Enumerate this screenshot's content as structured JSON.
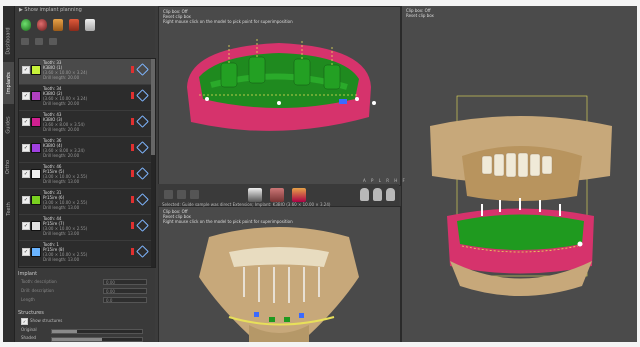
{
  "titlebar": "▶ Show implant planning",
  "side_tabs": [
    "Dashboard",
    "Implants",
    "Guides",
    "Ortho",
    "Teeth"
  ],
  "implants": [
    {
      "title": "Tooth: 33",
      "model": "K3BIO (1)",
      "dims": "(3.60 × 10.00 × 3.24)",
      "drill": "Drill length: 20.00",
      "color": "#c7f23a",
      "selected": true
    },
    {
      "title": "Tooth: 34",
      "model": "K3BIO (2)",
      "dims": "(3.60 × 10.00 × 3.24)",
      "drill": "Drill length: 20.00",
      "color": "#b040c0",
      "selected": false
    },
    {
      "title": "Tooth: 43",
      "model": "K3BIO (3)",
      "dims": "(3.60 × 8.00 × 3.54)",
      "drill": "Drill length: 20.00",
      "color": "#d02090",
      "selected": false
    },
    {
      "title": "Tooth: 36",
      "model": "K3BIO (4)",
      "dims": "(3.60 × 8.00 × 3.24)",
      "drill": "Drill length: 20.00",
      "color": "#a040e0",
      "selected": false
    },
    {
      "title": "Tooth: 46",
      "model": "Pr15ire (5)",
      "dims": "(3.00 × 10.00 × 2.55)",
      "drill": "Drill length: 13.00",
      "color": "#f0f0f0",
      "selected": false
    },
    {
      "title": "Tooth: 31",
      "model": "Pr15ire (6)",
      "dims": "(3.00 × 10.00 × 2.55)",
      "drill": "Drill length: 13.00",
      "color": "#7ad020",
      "selected": false
    },
    {
      "title": "Tooth: 44",
      "model": "Pr15ire (7)",
      "dims": "(3.00 × 10.00 × 2.55)",
      "drill": "Drill length: 13.00",
      "color": "#e0e0e0",
      "selected": false
    },
    {
      "title": "Tooth: 1",
      "model": "Pr15ire (8)",
      "dims": "(3.00 × 10.00 × 2.55)",
      "drill": "Drill length: 13.00",
      "color": "#6ab4ff",
      "selected": false
    }
  ],
  "implant_section": "Implant",
  "implant_props": [
    {
      "label": "Tooth: description",
      "value": "0.00"
    },
    {
      "label": "Drill: description",
      "value": "0.00"
    },
    {
      "label": "Length",
      "value": "0.0"
    },
    {
      "label": "Depth",
      "value": "0.0"
    }
  ],
  "structures_section": "Structures",
  "checkbox_label": "Show structures",
  "sliders": [
    {
      "label": "Original",
      "fill": 0.28
    },
    {
      "label": "Shaded",
      "fill": 0.55
    }
  ],
  "viewport1": {
    "line1": "Clip box: Off",
    "line2": "Reset clip box",
    "line3": "Right mouse click on the model to pick point for superimposition"
  },
  "middle_bar_text": "Selected: Guide sample was direct Extension; Implant: K3BIO (3.60 × 10.00 × 3.24)",
  "viewport2": {
    "line1": "Clip box: Off",
    "line2": "Reset clip box",
    "line3": "Right mouse click on the model to pick point for superimposition"
  },
  "viewport3": {
    "line1": "Clip box: Off",
    "line2": "Reset clip box"
  },
  "right_label": "A P L R H F",
  "colors": {
    "gingiva": "#d6336c",
    "guide": "#1f9a1f",
    "bone": "#c7a87a",
    "accent_yellow": "#e8e05a"
  }
}
